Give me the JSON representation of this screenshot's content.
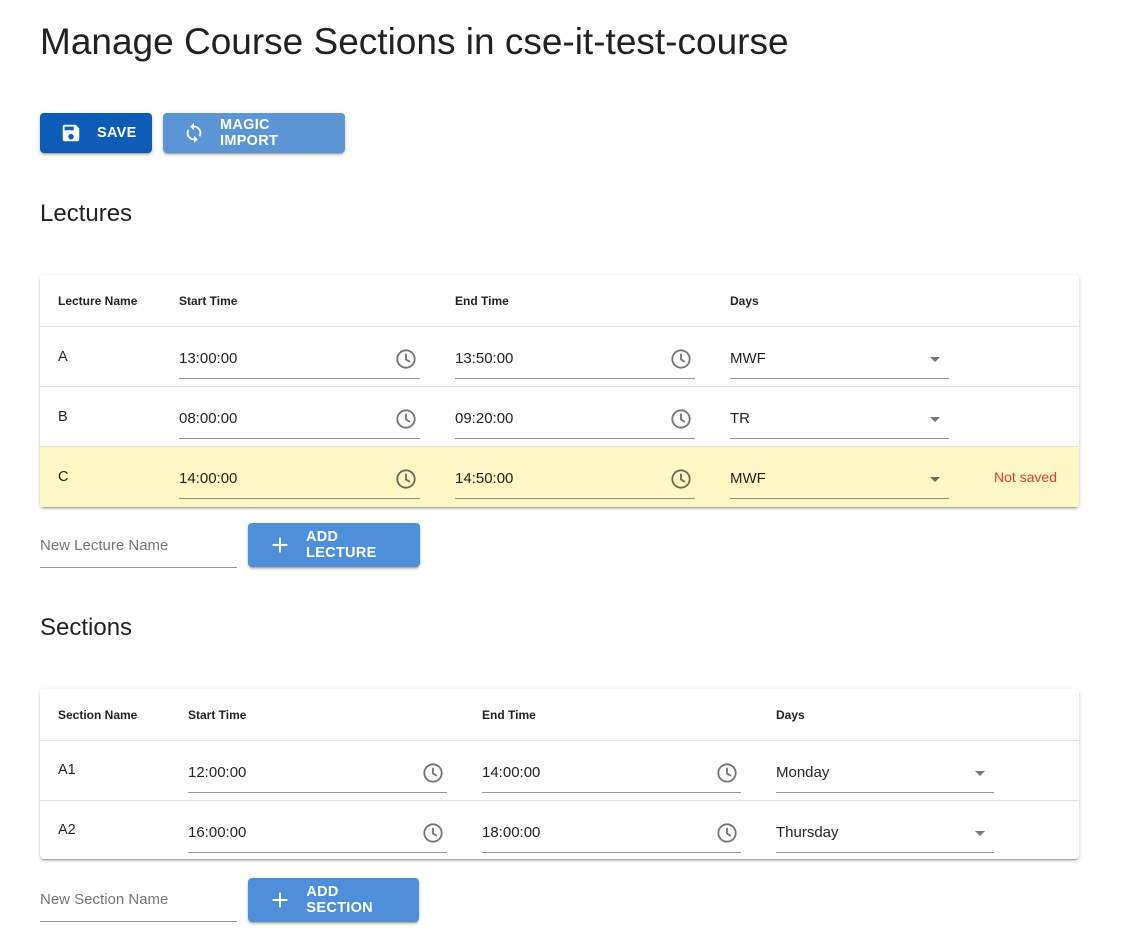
{
  "page": {
    "title": "Manage Course Sections in cse-it-test-course"
  },
  "toolbar": {
    "save_label": "SAVE",
    "magic_import_label": "MAGIC IMPORT"
  },
  "lectures": {
    "heading": "Lectures",
    "columns": [
      "Lecture Name",
      "Start Time",
      "End Time",
      "Days"
    ],
    "rows": [
      {
        "name": "A",
        "start": "13:00:00",
        "end": "13:50:00",
        "days": "MWF",
        "status": ""
      },
      {
        "name": "B",
        "start": "08:00:00",
        "end": "09:20:00",
        "days": "TR",
        "status": ""
      },
      {
        "name": "C",
        "start": "14:00:00",
        "end": "14:50:00",
        "days": "MWF",
        "status": "Not saved"
      }
    ],
    "new_placeholder": "New Lecture Name",
    "add_label": "ADD LECTURE"
  },
  "sections": {
    "heading": "Sections",
    "columns": [
      "Section Name",
      "Start Time",
      "End Time",
      "Days"
    ],
    "rows": [
      {
        "name": "A1",
        "start": "12:00:00",
        "end": "14:00:00",
        "days": "Monday"
      },
      {
        "name": "A2",
        "start": "16:00:00",
        "end": "18:00:00",
        "days": "Thursday"
      }
    ],
    "new_placeholder": "New Section Name",
    "add_label": "ADD SECTION"
  },
  "colors": {
    "save_button": "#0d5cb8",
    "magic_button": "#5b95d6",
    "add_button": "#4f8fd9",
    "unsaved_row": "#fff8c6",
    "unsaved_text": "#e53935"
  }
}
